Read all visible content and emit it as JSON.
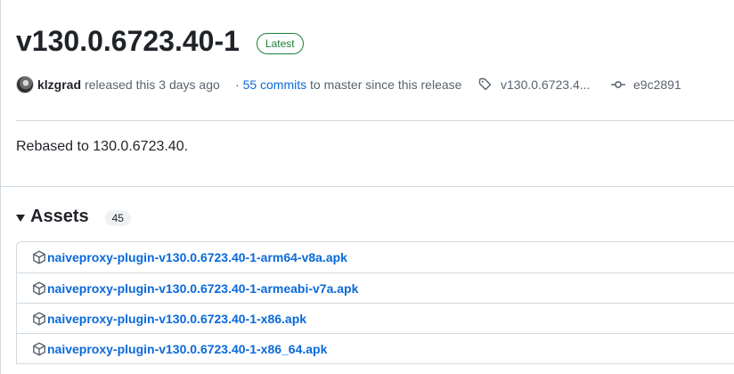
{
  "release": {
    "title": "v130.0.6723.40-1",
    "badge": "Latest"
  },
  "meta": {
    "author": "klzgrad",
    "released_text": "released this 3 days ago",
    "commits_prefix": "·",
    "commits_link": "55 commits",
    "commits_suffix": "to master since this release",
    "tag": "v130.0.6723.4...",
    "commit_sha": "e9c2891"
  },
  "notes": "Rebased to 130.0.6723.40.",
  "assets": {
    "title": "Assets",
    "count": "45",
    "items": [
      "naiveproxy-plugin-v130.0.6723.40-1-arm64-v8a.apk",
      "naiveproxy-plugin-v130.0.6723.40-1-armeabi-v7a.apk",
      "naiveproxy-plugin-v130.0.6723.40-1-x86.apk",
      "naiveproxy-plugin-v130.0.6723.40-1-x86_64.apk"
    ]
  },
  "colors": {
    "link": "#0969da",
    "latest": "#1a7f37",
    "muted": "#59636e",
    "border": "#d1d9e0"
  }
}
